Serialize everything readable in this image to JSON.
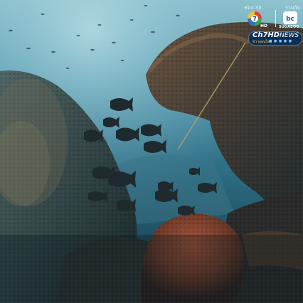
{
  "watermark": {
    "channel_number": "ช่อง 35",
    "partner_label": "ร่วมกับ",
    "hd_mark": "HD",
    "partner_name": "SUGABOO",
    "news_brand": "Ch7HD",
    "news_word": "NEWS",
    "news_tagline": "ข่าวออนไลน์"
  }
}
